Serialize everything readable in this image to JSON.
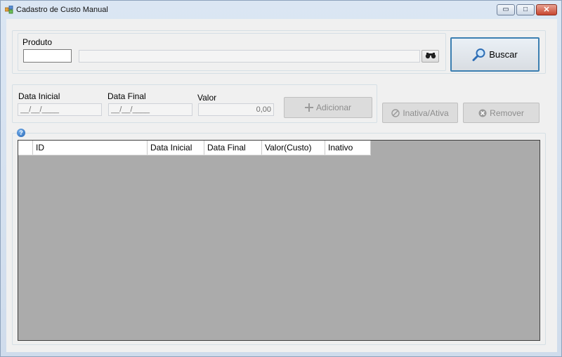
{
  "window": {
    "title": "Cadastro de Custo Manual",
    "controls": {
      "minimize": "▭",
      "maximize": "□",
      "close": "✕"
    }
  },
  "produto": {
    "label": "Produto",
    "code_value": "",
    "description_value": "",
    "lookup_icon": "binoculars-icon"
  },
  "buscar": {
    "label": "Buscar",
    "icon": "magnifier-icon"
  },
  "fields": {
    "data_inicial_label": "Data Inicial",
    "data_inicial_value": "__/__/____",
    "data_final_label": "Data Final",
    "data_final_value": "__/__/____",
    "valor_label": "Valor",
    "valor_value": "0,00"
  },
  "actions": {
    "adicionar": "Adicionar",
    "inativa_ativa": "Inativa/Ativa",
    "remover": "Remover"
  },
  "help": {
    "glyph": "?"
  },
  "grid": {
    "columns": [
      "",
      "ID",
      "Data Inicial",
      "Data Final",
      "Valor(Custo)",
      "Inativo"
    ]
  },
  "colors": {
    "grid_background": "#ababab",
    "primary_border": "#3c7fb1",
    "disabled_text": "#8d8d8d"
  }
}
